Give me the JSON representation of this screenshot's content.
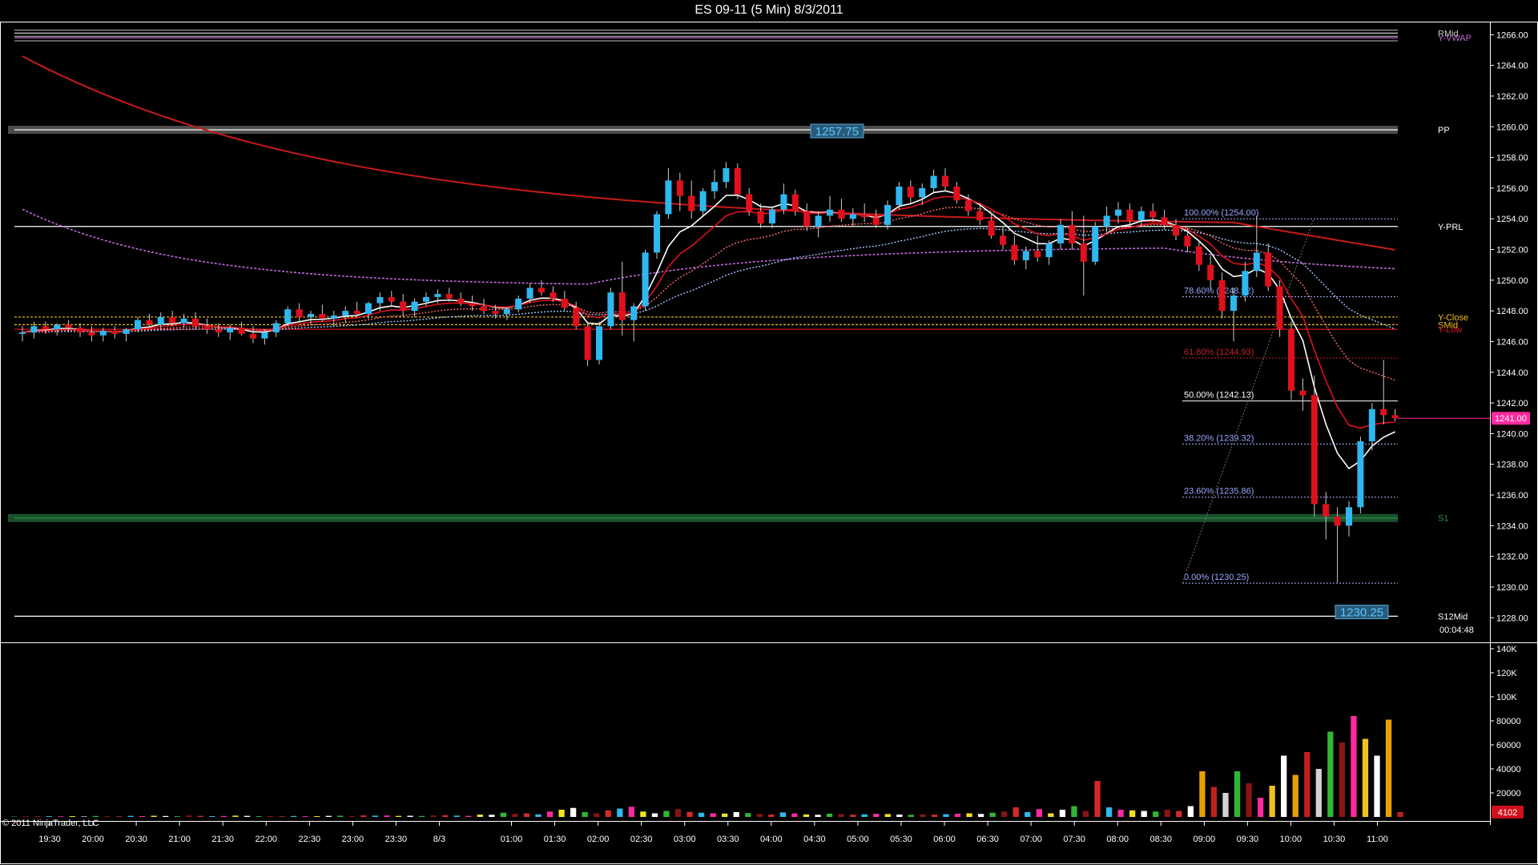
{
  "window": {
    "title": "ES 09-11 (5 Min)  8/3/2011",
    "copyright": "© 2011 NinjaTrader, LLC",
    "timer": "00:04:48"
  },
  "colors": {
    "background": "#000000",
    "up_candle": "#2fb7f0",
    "down_candle": "#e0101c",
    "axis": "#ffffff",
    "fib": "#9aa6ff",
    "ma_red": "#c81a1a",
    "vwap": "#c06bd8"
  },
  "chart_data": [
    {
      "type": "candlestick",
      "title": "ES 09-11 (5 Min)  8/3/2011",
      "ylim": [
        1226.5,
        1266.8
      ],
      "y_ticks": [
        "1266.00",
        "1264.00",
        "1262.00",
        "1260.00",
        "1258.00",
        "1256.00",
        "1254.00",
        "1252.00",
        "1250.00",
        "1248.00",
        "1246.00",
        "1244.00",
        "1242.00",
        "1240.00",
        "1238.00",
        "1236.00",
        "1234.00",
        "1232.00",
        "1230.00",
        "1228.00"
      ],
      "x_ticks": [
        "19:30",
        "20:00",
        "20:30",
        "21:00",
        "21:30",
        "22:00",
        "22:30",
        "23:00",
        "23:30",
        "8/3",
        "01:00",
        "01:30",
        "02:00",
        "02:30",
        "03:00",
        "03:30",
        "04:00",
        "04:30",
        "05:00",
        "05:30",
        "06:00",
        "06:30",
        "07:00",
        "07:30",
        "08:00",
        "08:30",
        "09:00",
        "09:30",
        "10:00",
        "10:30",
        "11:00"
      ],
      "price_marker": "1241.00",
      "levels": [
        {
          "label": "RMid",
          "price": 1266.1,
          "color": "#cccccc"
        },
        {
          "label": "Y-VWAP",
          "price": 1265.8,
          "color": "#c06bd8"
        },
        {
          "label": "PP",
          "price": 1259.8,
          "color": "#ffffff"
        },
        {
          "label": "Y-PRL",
          "price": 1253.5,
          "color": "#ffffff"
        },
        {
          "label": "Y-Close",
          "price": 1247.6,
          "color": "#f0c020"
        },
        {
          "label": "SMid",
          "price": 1247.1,
          "color": "#f0c020"
        },
        {
          "label": "Y-Low",
          "price": 1246.8,
          "color": "#e0101c"
        },
        {
          "label": "S1",
          "price": 1234.5,
          "color": "#2a8a4a"
        },
        {
          "label": "S12Mid",
          "price": 1228.1,
          "color": "#ffffff"
        }
      ],
      "box_labels": [
        {
          "text": "1257.75",
          "price": 1259.75
        },
        {
          "text": "1230.25",
          "price": 1228.4
        }
      ],
      "fib_levels": [
        {
          "label": "100.00% (1254.00)",
          "price": 1254.0
        },
        {
          "label": "78.60% (1248.92)",
          "price": 1248.92
        },
        {
          "label": "61.80% (1244.93)",
          "price": 1244.93
        },
        {
          "label": "50.00% (1242.13)",
          "price": 1242.13
        },
        {
          "label": "38.20% (1239.32)",
          "price": 1239.32
        },
        {
          "label": "23.60% (1235.86)",
          "price": 1235.86
        },
        {
          "label": "0.00% (1230.25)",
          "price": 1230.25
        }
      ],
      "candles_ohlc": [
        [
          1246.5,
          1247.0,
          1246.0,
          1246.6
        ],
        [
          1246.6,
          1247.3,
          1246.2,
          1247.0
        ],
        [
          1247.0,
          1247.3,
          1246.5,
          1246.8
        ],
        [
          1246.8,
          1247.2,
          1246.4,
          1247.1
        ],
        [
          1247.1,
          1247.4,
          1246.6,
          1246.9
        ],
        [
          1246.9,
          1247.2,
          1246.3,
          1246.6
        ],
        [
          1246.6,
          1247.0,
          1246.0,
          1246.4
        ],
        [
          1246.4,
          1246.9,
          1246.0,
          1246.7
        ],
        [
          1246.7,
          1247.0,
          1246.2,
          1246.5
        ],
        [
          1246.5,
          1246.9,
          1246.0,
          1246.8
        ],
        [
          1246.8,
          1247.6,
          1246.6,
          1247.4
        ],
        [
          1247.4,
          1247.8,
          1246.9,
          1247.1
        ],
        [
          1247.1,
          1247.9,
          1246.8,
          1247.6
        ],
        [
          1247.6,
          1248.0,
          1247.0,
          1247.2
        ],
        [
          1247.2,
          1247.8,
          1246.9,
          1247.5
        ],
        [
          1247.5,
          1247.9,
          1246.8,
          1247.0
        ],
        [
          1247.0,
          1247.5,
          1246.5,
          1246.8
        ],
        [
          1246.8,
          1247.2,
          1246.3,
          1246.6
        ],
        [
          1246.6,
          1247.1,
          1246.1,
          1246.9
        ],
        [
          1246.9,
          1247.3,
          1246.4,
          1246.5
        ],
        [
          1246.5,
          1247.0,
          1245.9,
          1246.2
        ],
        [
          1246.2,
          1246.8,
          1245.8,
          1246.6
        ],
        [
          1246.6,
          1247.4,
          1246.3,
          1247.2
        ],
        [
          1247.2,
          1248.3,
          1247.0,
          1248.1
        ],
        [
          1248.1,
          1248.5,
          1247.3,
          1247.6
        ],
        [
          1247.6,
          1248.0,
          1247.1,
          1247.8
        ],
        [
          1247.8,
          1248.4,
          1247.3,
          1247.5
        ],
        [
          1247.5,
          1248.0,
          1247.0,
          1247.7
        ],
        [
          1247.7,
          1248.3,
          1247.2,
          1248.0
        ],
        [
          1248.0,
          1248.6,
          1247.6,
          1247.8
        ],
        [
          1247.8,
          1248.6,
          1247.5,
          1248.5
        ],
        [
          1248.5,
          1249.2,
          1248.0,
          1248.9
        ],
        [
          1248.9,
          1249.3,
          1248.3,
          1248.6
        ],
        [
          1248.6,
          1249.1,
          1247.6,
          1248.0
        ],
        [
          1248.0,
          1248.8,
          1247.6,
          1248.6
        ],
        [
          1248.6,
          1249.2,
          1248.3,
          1248.9
        ],
        [
          1248.9,
          1249.4,
          1248.5,
          1249.1
        ],
        [
          1249.1,
          1249.5,
          1248.6,
          1248.8
        ],
        [
          1248.8,
          1249.2,
          1248.3,
          1248.5
        ],
        [
          1248.5,
          1249.0,
          1248.0,
          1248.3
        ],
        [
          1248.3,
          1248.8,
          1247.8,
          1248.0
        ],
        [
          1248.0,
          1248.4,
          1247.5,
          1247.8
        ],
        [
          1247.8,
          1248.2,
          1247.4,
          1248.1
        ],
        [
          1248.1,
          1249.0,
          1247.9,
          1248.8
        ],
        [
          1248.8,
          1249.8,
          1248.5,
          1249.5
        ],
        [
          1249.5,
          1250.0,
          1249.0,
          1249.2
        ],
        [
          1249.2,
          1249.6,
          1248.6,
          1248.8
        ],
        [
          1248.8,
          1249.3,
          1248.0,
          1248.2
        ],
        [
          1248.2,
          1248.6,
          1246.8,
          1247.0
        ],
        [
          1247.0,
          1247.3,
          1244.4,
          1244.8
        ],
        [
          1244.8,
          1247.3,
          1244.5,
          1247.0
        ],
        [
          1247.0,
          1249.5,
          1246.8,
          1249.2
        ],
        [
          1249.2,
          1251.2,
          1246.4,
          1247.4
        ],
        [
          1247.4,
          1248.5,
          1246.0,
          1248.3
        ],
        [
          1248.3,
          1252.0,
          1248.0,
          1251.8
        ],
        [
          1251.8,
          1254.5,
          1251.4,
          1254.3
        ],
        [
          1254.3,
          1257.3,
          1254.0,
          1256.5
        ],
        [
          1256.5,
          1257.0,
          1254.5,
          1255.5
        ],
        [
          1255.5,
          1256.5,
          1254.0,
          1254.5
        ],
        [
          1254.5,
          1256.0,
          1254.2,
          1255.8
        ],
        [
          1255.8,
          1257.2,
          1255.3,
          1256.4
        ],
        [
          1256.4,
          1257.7,
          1256.0,
          1257.3
        ],
        [
          1257.3,
          1257.6,
          1255.3,
          1255.6
        ],
        [
          1255.6,
          1256.0,
          1254.2,
          1254.5
        ],
        [
          1254.5,
          1255.0,
          1253.4,
          1253.7
        ],
        [
          1253.7,
          1254.8,
          1253.4,
          1254.6
        ],
        [
          1254.6,
          1256.3,
          1254.3,
          1255.6
        ],
        [
          1255.6,
          1255.9,
          1254.2,
          1254.5
        ],
        [
          1254.5,
          1255.0,
          1253.2,
          1253.5
        ],
        [
          1253.5,
          1254.5,
          1252.8,
          1254.2
        ],
        [
          1254.2,
          1255.5,
          1253.8,
          1254.6
        ],
        [
          1254.6,
          1255.3,
          1253.8,
          1254.0
        ],
        [
          1254.0,
          1254.7,
          1253.5,
          1254.3
        ],
        [
          1254.3,
          1255.0,
          1253.8,
          1254.1
        ],
        [
          1254.1,
          1254.6,
          1253.4,
          1253.6
        ],
        [
          1253.6,
          1255.2,
          1253.3,
          1254.9
        ],
        [
          1254.9,
          1256.4,
          1254.6,
          1256.1
        ],
        [
          1256.1,
          1256.5,
          1255.0,
          1255.4
        ],
        [
          1255.4,
          1256.3,
          1254.9,
          1256.0
        ],
        [
          1256.0,
          1257.2,
          1255.7,
          1256.8
        ],
        [
          1256.8,
          1257.3,
          1255.8,
          1256.1
        ],
        [
          1256.1,
          1256.4,
          1255.0,
          1255.2
        ],
        [
          1255.2,
          1255.6,
          1254.2,
          1254.5
        ],
        [
          1254.5,
          1255.0,
          1253.6,
          1253.9
        ],
        [
          1253.9,
          1254.4,
          1252.7,
          1252.9
        ],
        [
          1252.9,
          1253.5,
          1252.0,
          1252.3
        ],
        [
          1252.3,
          1252.9,
          1251.0,
          1251.3
        ],
        [
          1251.3,
          1252.2,
          1250.7,
          1251.9
        ],
        [
          1251.9,
          1252.9,
          1251.2,
          1251.5
        ],
        [
          1251.5,
          1252.6,
          1251.0,
          1252.4
        ],
        [
          1252.4,
          1254.0,
          1252.0,
          1253.6
        ],
        [
          1253.6,
          1254.5,
          1252.0,
          1252.4
        ],
        [
          1252.4,
          1254.2,
          1249.0,
          1251.2
        ],
        [
          1251.2,
          1253.8,
          1251.0,
          1253.5
        ],
        [
          1253.5,
          1254.8,
          1253.0,
          1254.2
        ],
        [
          1254.2,
          1255.1,
          1253.7,
          1254.6
        ],
        [
          1254.6,
          1255.0,
          1253.5,
          1253.9
        ],
        [
          1253.9,
          1254.8,
          1253.5,
          1254.5
        ],
        [
          1254.5,
          1255.0,
          1253.8,
          1254.1
        ],
        [
          1254.1,
          1254.6,
          1253.3,
          1253.6
        ],
        [
          1253.6,
          1254.0,
          1252.6,
          1252.9
        ],
        [
          1252.9,
          1253.4,
          1251.8,
          1252.2
        ],
        [
          1252.2,
          1252.6,
          1250.6,
          1251.0
        ],
        [
          1251.0,
          1251.6,
          1249.4,
          1250.0
        ],
        [
          1250.0,
          1250.5,
          1247.5,
          1248.0
        ],
        [
          1248.0,
          1249.5,
          1246.0,
          1249.0
        ],
        [
          1249.0,
          1251.2,
          1248.6,
          1250.6
        ],
        [
          1250.6,
          1254.2,
          1250.2,
          1251.8
        ],
        [
          1251.8,
          1252.4,
          1249.3,
          1249.6
        ],
        [
          1249.6,
          1250.0,
          1246.3,
          1246.8
        ],
        [
          1246.8,
          1247.3,
          1242.2,
          1242.8
        ],
        [
          1242.8,
          1243.6,
          1241.5,
          1242.5
        ],
        [
          1242.5,
          1243.8,
          1234.6,
          1235.4
        ],
        [
          1235.4,
          1236.2,
          1233.1,
          1234.6
        ],
        [
          1234.6,
          1235.2,
          1230.3,
          1234.0
        ],
        [
          1234.0,
          1235.6,
          1233.3,
          1235.2
        ],
        [
          1235.2,
          1239.8,
          1234.8,
          1239.5
        ],
        [
          1239.5,
          1242.0,
          1238.9,
          1241.6
        ],
        [
          1241.6,
          1244.8,
          1240.6,
          1241.2
        ],
        [
          1241.2,
          1241.6,
          1240.8,
          1241.0
        ]
      ],
      "volume_bars": [
        300,
        500,
        400,
        600,
        500,
        700,
        400,
        800,
        600,
        500,
        900,
        700,
        1000,
        800,
        600,
        1200,
        900,
        700,
        800,
        1100,
        900,
        600,
        700,
        500,
        800,
        600,
        700,
        900,
        1000,
        800,
        1300,
        1100,
        1200,
        900,
        1000,
        800,
        1200,
        1500,
        1100,
        900,
        2000,
        1800,
        3500,
        2500,
        3000,
        2200,
        4500,
        6000,
        7500,
        4000,
        3000,
        5500,
        7000,
        8500,
        4500,
        3000,
        5000,
        6500,
        4200,
        3500,
        3000,
        2800,
        4000,
        3200,
        2500,
        2000,
        3800,
        2900,
        2100,
        1800,
        2700,
        2300,
        1900,
        2200,
        2600,
        2400,
        2000,
        1800,
        2100,
        1900,
        2300,
        2700,
        3000,
        2500,
        3500,
        4500,
        8000,
        4000,
        6500,
        3000,
        6000,
        9000,
        5000,
        30000,
        8000,
        6000,
        5500,
        5000,
        4500,
        6000,
        5000,
        9000,
        38000,
        25000,
        20000,
        38000,
        28000,
        16000,
        26000,
        51000,
        35000,
        54000,
        40000,
        71000,
        62000,
        84000,
        65000,
        51000,
        81000,
        4102
      ],
      "volume_y_ticks": [
        "140K",
        "120K",
        "100K",
        "80000",
        "60000",
        "40000",
        "20000"
      ],
      "volume_marker": "4102",
      "volume_ylim": [
        0,
        140000
      ]
    }
  ]
}
